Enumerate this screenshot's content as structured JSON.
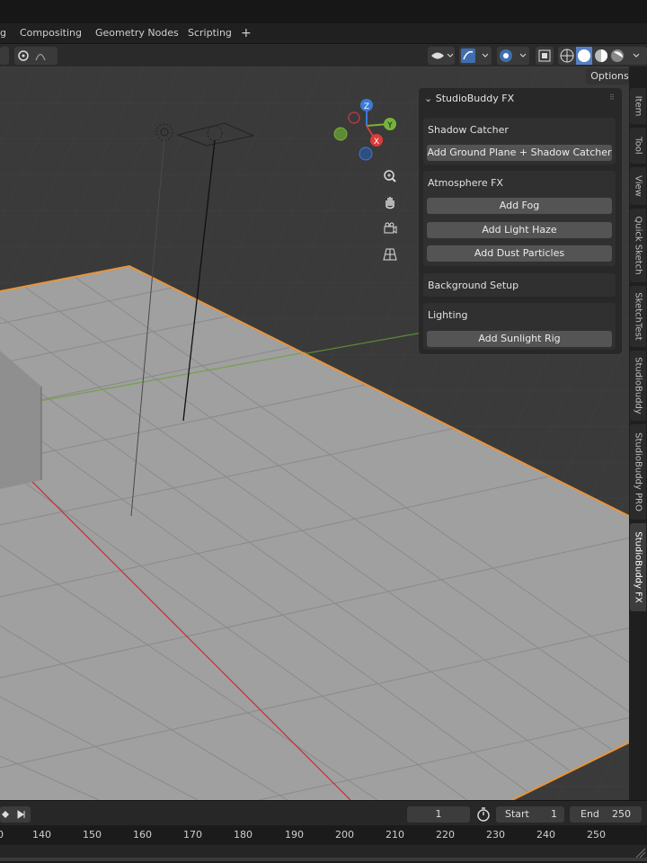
{
  "workspace_tabs": [
    "g",
    "Compositing",
    "Geometry Nodes",
    "Scripting",
    "+"
  ],
  "header": {
    "options_label": "Options"
  },
  "gizmo_axes": {
    "z": "Z",
    "y": "Y",
    "x": "X"
  },
  "npanel": {
    "title": "StudioBuddy FX",
    "sections": [
      {
        "title": "Shadow Catcher",
        "buttons": [
          "Add Ground Plane + Shadow Catcher"
        ]
      },
      {
        "title": "Atmosphere FX",
        "buttons": [
          "Add Fog",
          "Add Light Haze",
          "Add Dust Particles"
        ]
      },
      {
        "title": "Background Setup",
        "buttons": []
      },
      {
        "title": "Lighting",
        "buttons": [
          "Add Sunlight Rig"
        ]
      }
    ]
  },
  "side_tabs": [
    "Item",
    "Tool",
    "View",
    "Quick Sketch",
    "SketchTest",
    "StudioBuddy",
    "StudioBuddy PRO",
    "StudioBuddy FX"
  ],
  "active_side_tab": "StudioBuddy FX",
  "timeline": {
    "current_frame": "1",
    "start_label": "Start",
    "start_value": "1",
    "end_label": "End",
    "end_value": "250",
    "ticks": [
      "0",
      "140",
      "150",
      "160",
      "170",
      "180",
      "190",
      "200",
      "210",
      "220",
      "230",
      "240",
      "250"
    ]
  },
  "colors": {
    "selection_outline": "#e8943a",
    "x_axis": "#d83c3c",
    "y_axis": "#76b33c",
    "z_axis": "#3c7ad8",
    "plane": "#9d9d9d"
  }
}
